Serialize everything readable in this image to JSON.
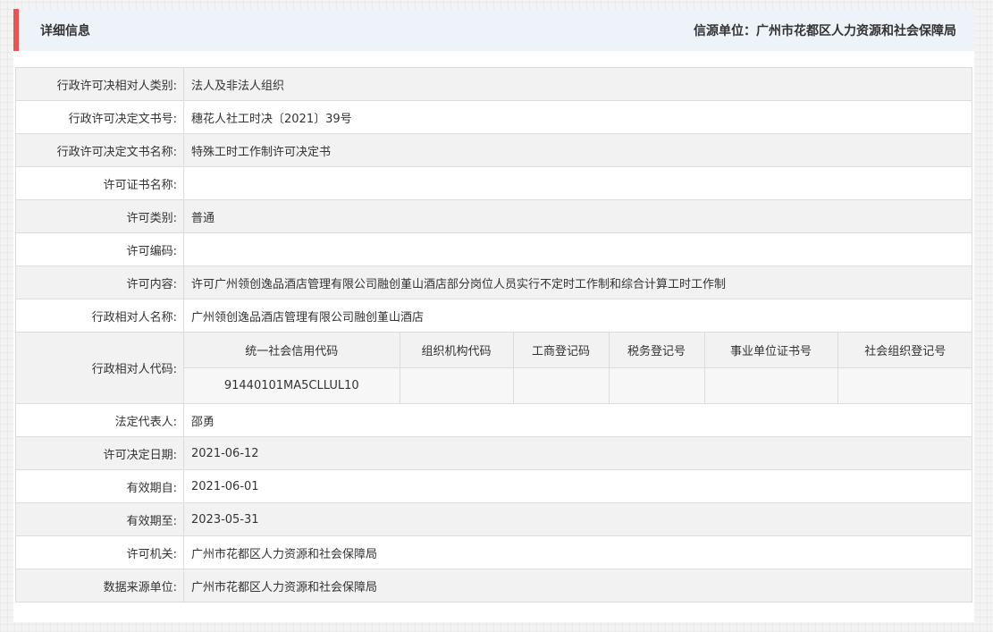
{
  "header": {
    "title": "详细信息",
    "source": "信源单位：广州市花都区人力资源和社会保障局"
  },
  "rows": {
    "subject_type": {
      "label": "行政许可决相对人类别:",
      "value": "法人及非法人组织"
    },
    "doc_number": {
      "label": "行政许可决定文书号:",
      "value": "穗花人社工时决〔2021〕39号"
    },
    "doc_name": {
      "label": "行政许可决定文书名称:",
      "value": "特殊工时工作制许可决定书"
    },
    "cert_name": {
      "label": "许可证书名称:",
      "value": ""
    },
    "category": {
      "label": "许可类别:",
      "value": "普通"
    },
    "code": {
      "label": "许可编码:",
      "value": ""
    },
    "content": {
      "label": "许可内容:",
      "value": "许可广州领创逸品酒店管理有限公司融创堇山酒店部分岗位人员实行不定时工作制和综合计算工时工作制"
    },
    "subject_name": {
      "label": "行政相对人名称:",
      "value": "广州领创逸品酒店管理有限公司融创堇山酒店"
    },
    "subject_code": {
      "label": "行政相对人代码:",
      "headers": [
        "统一社会信用代码",
        "组织机构代码",
        "工商登记码",
        "税务登记号",
        "事业单位证书号",
        "社会组织登记号"
      ],
      "values": [
        "91440101MA5CLLUL10",
        "",
        "",
        "",
        "",
        ""
      ]
    },
    "legal_rep": {
      "label": "法定代表人:",
      "value": "邵勇"
    },
    "decision_date": {
      "label": "许可决定日期:",
      "value": "2021-06-12"
    },
    "valid_from": {
      "label": "有效期自:",
      "value": "2021-06-01"
    },
    "valid_to": {
      "label": "有效期至:",
      "value": "2023-05-31"
    },
    "authority": {
      "label": "许可机关:",
      "value": "广州市花都区人力资源和社会保障局"
    },
    "data_source": {
      "label": "数据来源单位:",
      "value": "广州市花都区人力资源和社会保障局"
    }
  }
}
